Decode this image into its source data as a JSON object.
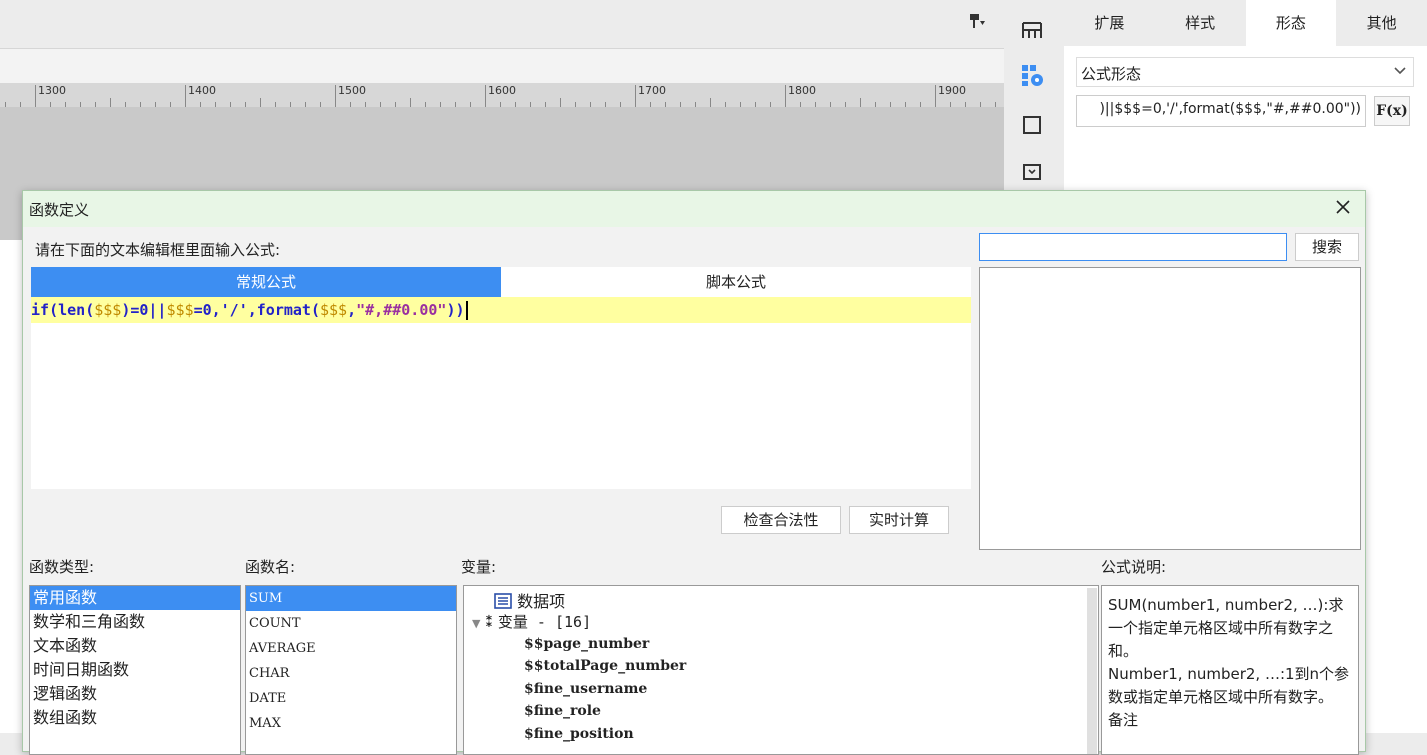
{
  "designer": {
    "ruler_numbers": [
      "1300",
      "1400",
      "1500",
      "1600",
      "1700",
      "1800",
      "1900"
    ]
  },
  "icons": {
    "format_painter": "format-painter-icon",
    "side": [
      "layout-grid-icon",
      "component-settings-icon",
      "square-icon",
      "dropdown-box-icon"
    ]
  },
  "panel": {
    "tabs": [
      "扩展",
      "样式",
      "形态",
      "其他"
    ],
    "active_tab": "形态",
    "form_type": "公式形态",
    "formula_value": ")||$$$=0,'/',format($$$,\"#,##0.00\"))",
    "fx_label": "F(x)"
  },
  "dialog": {
    "title": "函数定义",
    "prompt": "请在下面的文本编辑框里面输入公式:",
    "tabs": [
      "常规公式",
      "脚本公式"
    ],
    "formula_parts": [
      "if",
      "(",
      "len",
      "(",
      "$$$",
      ")=0",
      "||",
      "$$$",
      "=0,'/',",
      "format",
      "(",
      "$$$",
      ",",
      "\"#,##0.00\"",
      "))"
    ],
    "check_button": "检查合法性",
    "calc_button": "实时计算",
    "search_button": "搜索",
    "search_value": "",
    "labels": {
      "category": "函数类型:",
      "name": "函数名:",
      "variables": "变量:",
      "description": "公式说明:"
    },
    "categories": [
      "常用函数",
      "数学和三角函数",
      "文本函数",
      "时间日期函数",
      "逻辑函数",
      "数组函数"
    ],
    "functions": [
      "SUM",
      "COUNT",
      "AVERAGE",
      "CHAR",
      "DATE",
      "MAX"
    ],
    "variables": {
      "data_item": "数据项",
      "var_group": "变量 - [16]",
      "items": [
        "$$page_number",
        "$$totalPage_number",
        "$fine_username",
        "$fine_role",
        "$fine_position"
      ]
    },
    "description": {
      "line1": "SUM(number1, number2, …):求一个指定单元格区域中所有数字之和。",
      "line2": "Number1, number2, …:1到n个参数或指定单元格区域中所有数字。",
      "line3": "备注"
    }
  },
  "colors": {
    "accent": "#3d8ef2",
    "editor_highlight": "#ffffa0",
    "dialog_title_bg": "#e8f6e6"
  }
}
